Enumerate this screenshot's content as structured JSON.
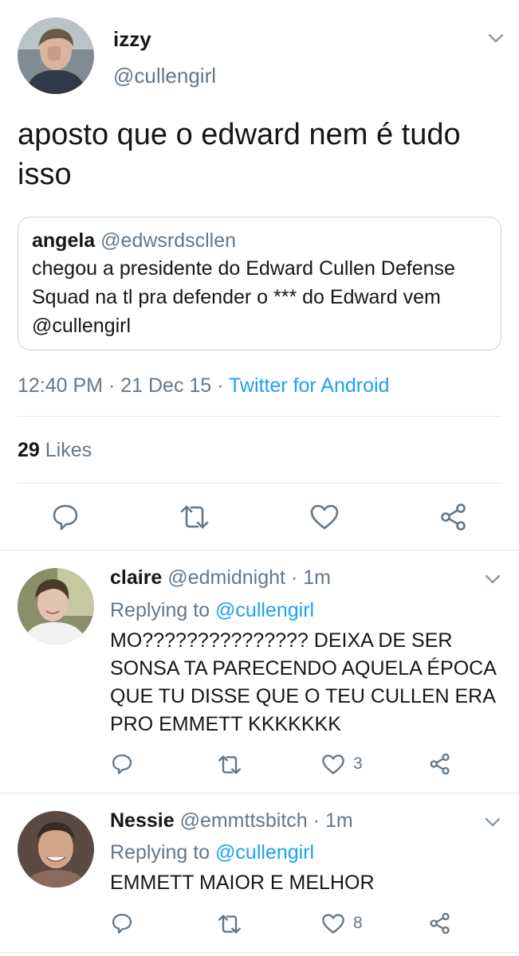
{
  "main_tweet": {
    "display_name": "izzy",
    "handle": "@cullengirl",
    "text_line1": "aposto que o edward nem é tudo",
    "text_line2": "isso",
    "quote": {
      "display_name": "angela",
      "handle": "@edwsrdscllen",
      "line1": "chegou a presidente do Edward Cullen Defense",
      "line2": "Squad na tl pra defender o *** do Edward vem",
      "line3": "@cullengirl"
    },
    "time": "12:40 PM",
    "date": "21 Dec 15",
    "separator": "·",
    "source": "Twitter for Android",
    "likes_count": "29",
    "likes_label": "Likes"
  },
  "replies": [
    {
      "display_name": "claire",
      "handle": "@edmidnight",
      "time": "1m",
      "replying_to_label": "Replying to",
      "replying_to_handle": "@cullengirl",
      "line1": "MO??????????????? DEIXA DE SER",
      "line2": "SONSA TA PARECENDO AQUELA ÉPOCA",
      "line3": "QUE TU DISSE QUE O TEU CULLEN ERA",
      "line4": "PRO EMMETT KKKKKKK",
      "like_count": "3"
    },
    {
      "display_name": "Nessie",
      "handle": "@emmttsbitch",
      "time": "1m",
      "replying_to_label": "Replying to",
      "replying_to_handle": "@cullengirl",
      "line1": "EMMETT MAIOR E MELHOR",
      "like_count": "8"
    }
  ],
  "colors": {
    "accent": "#1da1f2",
    "muted": "#657786",
    "divider": "#e1e8ed"
  },
  "icons": [
    "chevron-down-icon",
    "reply-icon",
    "retweet-icon",
    "like-icon",
    "share-icon"
  ]
}
